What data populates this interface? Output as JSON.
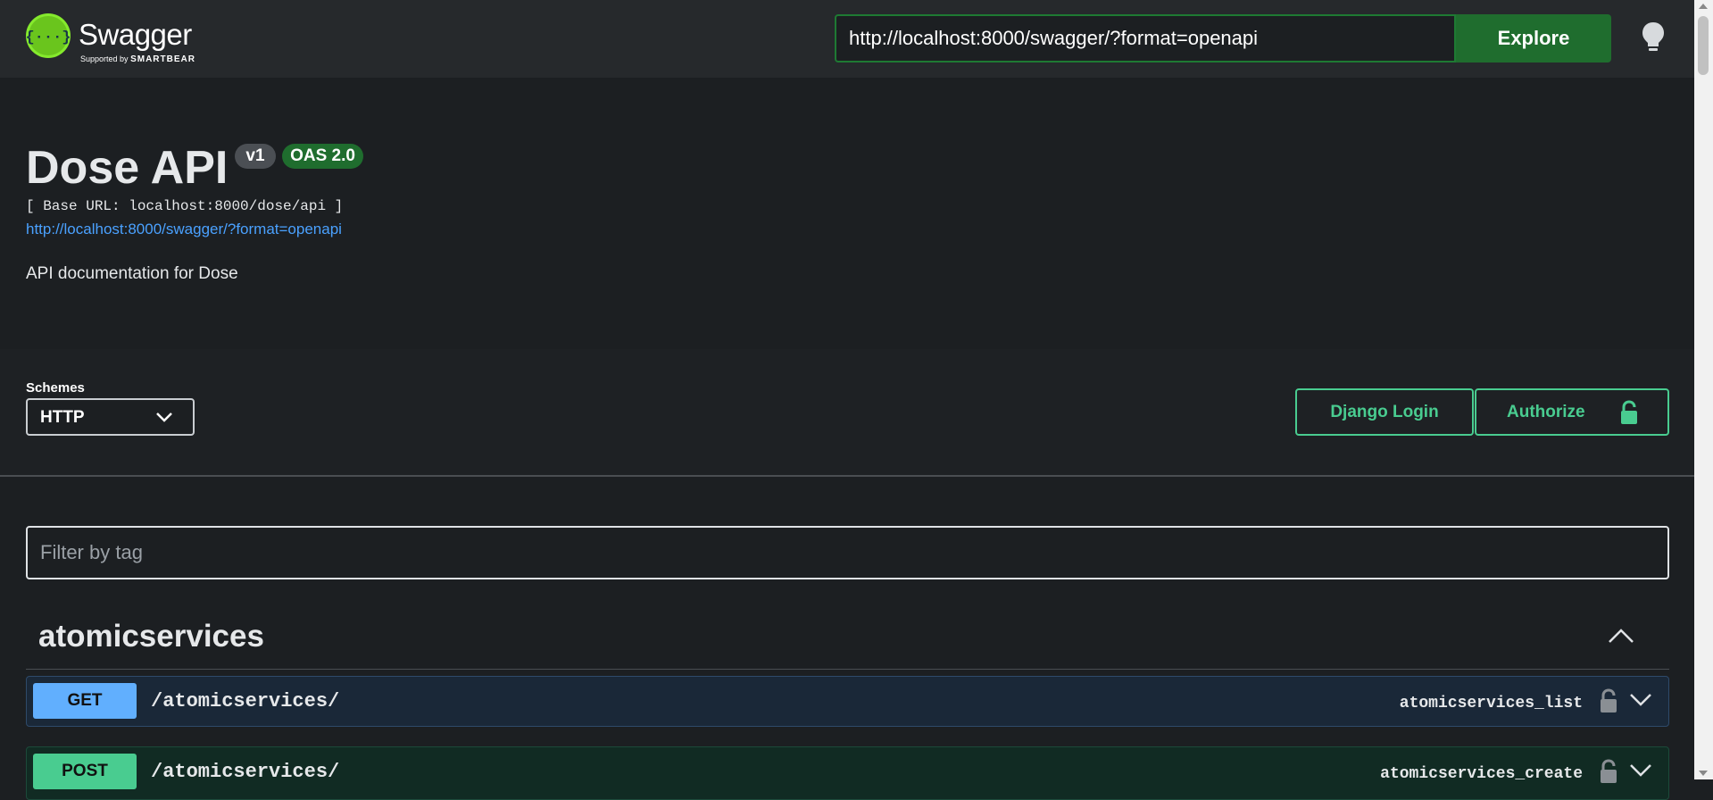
{
  "topbar": {
    "brand": "Swagger",
    "brand_sub_prefix": "Supported by",
    "brand_sub_company": "SMARTBEAR",
    "url_value": "http://localhost:8000/swagger/?format=openapi",
    "explore_label": "Explore",
    "accent": "#1f6d2e"
  },
  "info": {
    "title": "Dose API",
    "version_badge": "v1",
    "oas_badge": "OAS 2.0",
    "base_url": "[ Base URL: localhost:8000/dose/api ]",
    "spec_link": "http://localhost:8000/swagger/?format=openapi",
    "description": "API documentation for Dose"
  },
  "schemes": {
    "label": "Schemes",
    "selected": "HTTP"
  },
  "auth": {
    "django_login_label": "Django Login",
    "authorize_label": "Authorize",
    "accent": "#49cc90"
  },
  "filter": {
    "placeholder": "Filter by tag",
    "value": ""
  },
  "tag": {
    "name": "atomicservices",
    "operations": [
      {
        "method": "GET",
        "path": "/atomicservices/",
        "operation_id": "atomicservices_list",
        "color": "#61affe"
      },
      {
        "method": "POST",
        "path": "/atomicservices/",
        "operation_id": "atomicservices_create",
        "color": "#49cc90"
      }
    ]
  },
  "icons": [
    "swagger-logo-icon",
    "lightbulb-icon",
    "chevron-down-icon",
    "lock-icon",
    "chevron-up-icon"
  ]
}
